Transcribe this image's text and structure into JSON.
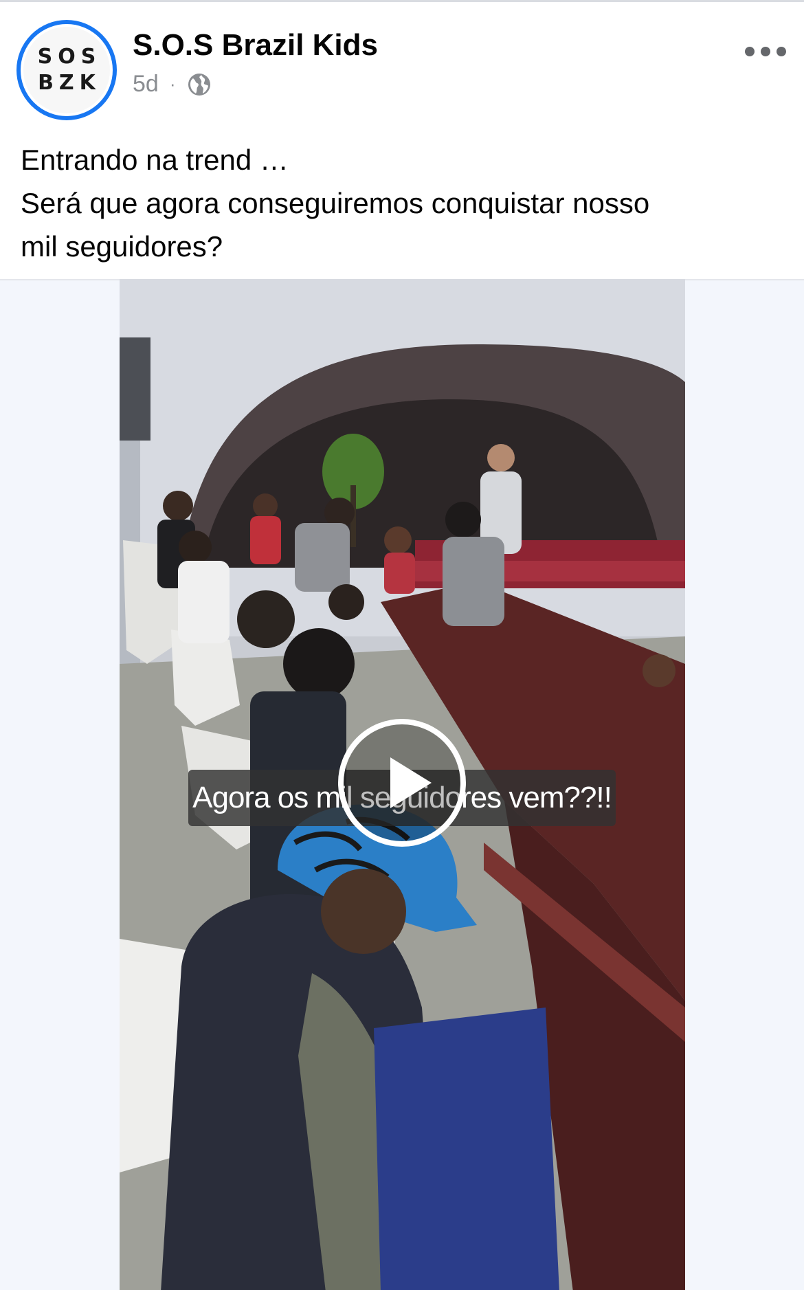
{
  "post": {
    "avatar": {
      "line1": "SOS",
      "line2": "BZK",
      "ring_color": "#1877f2"
    },
    "page_name": "S.O.S Brazil Kids",
    "time_ago": "5d",
    "separator": "·",
    "privacy_icon": "globe-icon",
    "more_icon": "more-options-icon",
    "caption_lines": [
      "Entrando na trend …",
      "Será que agora conseguiremos conquistar nosso",
      "mil seguidores?"
    ],
    "video": {
      "overlay_caption": "Agora os mil seguidores vem??!!",
      "play_icon": "play-icon"
    }
  }
}
